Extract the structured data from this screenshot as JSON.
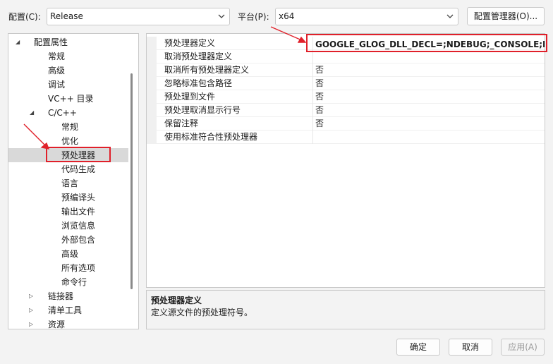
{
  "config": {
    "label": "配置(C):",
    "value": "Release"
  },
  "platform": {
    "label": "平台(P):",
    "value": "x64"
  },
  "config_manager_button": "配置管理器(O)...",
  "tree": [
    {
      "label": "配置属性",
      "arrow": "expanded"
    },
    {
      "label": "常规"
    },
    {
      "label": "高级"
    },
    {
      "label": "调试"
    },
    {
      "label": "VC++ 目录"
    },
    {
      "label": "C/C++",
      "arrow": "expanded"
    },
    {
      "label": "常规"
    },
    {
      "label": "优化"
    },
    {
      "label": "预处理器",
      "selected": true
    },
    {
      "label": "代码生成"
    },
    {
      "label": "语言"
    },
    {
      "label": "预编译头"
    },
    {
      "label": "输出文件"
    },
    {
      "label": "浏览信息"
    },
    {
      "label": "外部包含"
    },
    {
      "label": "高级"
    },
    {
      "label": "所有选项"
    },
    {
      "label": "命令行"
    },
    {
      "label": "链接器",
      "arrow": "collapsed"
    },
    {
      "label": "清单工具",
      "arrow": "collapsed"
    },
    {
      "label": "资源",
      "arrow": "collapsed"
    }
  ],
  "properties": [
    {
      "name": "预处理器定义",
      "value": "GOOGLE_GLOG_DLL_DECL=;NDEBUG;_CONSOLE;BOOS"
    },
    {
      "name": "取消预处理器定义",
      "value": ""
    },
    {
      "name": "取消所有预处理器定义",
      "value": "否"
    },
    {
      "name": "忽略标准包含路径",
      "value": "否"
    },
    {
      "name": "预处理到文件",
      "value": "否"
    },
    {
      "name": "预处理取消显示行号",
      "value": "否"
    },
    {
      "name": "保留注释",
      "value": "否"
    },
    {
      "name": "使用标准符合性预处理器",
      "value": ""
    }
  ],
  "description": {
    "title": "预处理器定义",
    "text": "定义源文件的预处理符号。"
  },
  "buttons": {
    "ok": "确定",
    "cancel": "取消",
    "apply": "应用(A)"
  },
  "colors": {
    "annotation": "#e0202a",
    "selected_row": "#d9d9d9"
  },
  "icons": {
    "expanded": "triangle-down-right",
    "collapsed": "triangle-right",
    "dropdown": "chevron-down"
  }
}
